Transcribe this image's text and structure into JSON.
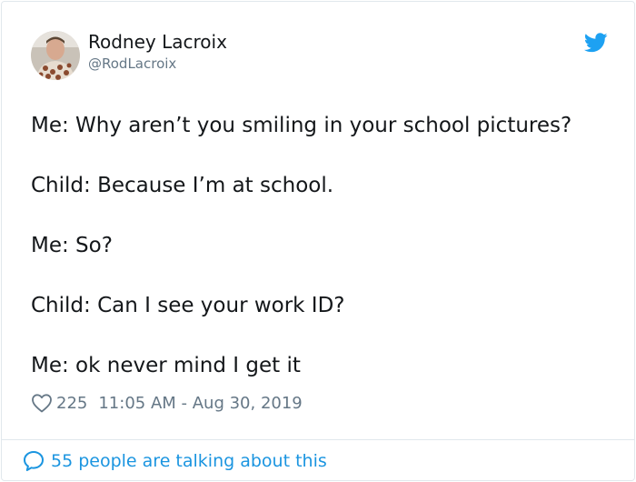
{
  "author": {
    "display_name": "Rodney Lacroix",
    "handle": "@RodLacroix"
  },
  "brand": {
    "icon": "twitter-bird-icon",
    "color": "#1da1f2"
  },
  "tweet": {
    "lines": [
      "Me: Why aren’t you smiling in your school pictures?",
      "Child: Because I’m at school.",
      "Me: So?",
      "Child: Can I see your work ID?",
      "Me: ok never mind I get it"
    ]
  },
  "meta": {
    "like_icon": "heart-icon",
    "like_count": "225",
    "timestamp": "11:05 AM - Aug 30, 2019"
  },
  "conversation": {
    "icon": "speech-bubble-icon",
    "label": "55 people are talking about this",
    "color": "#1b95e0"
  },
  "colors": {
    "text_primary": "#14171a",
    "text_secondary": "#657786",
    "border": "#e1e8ed"
  }
}
